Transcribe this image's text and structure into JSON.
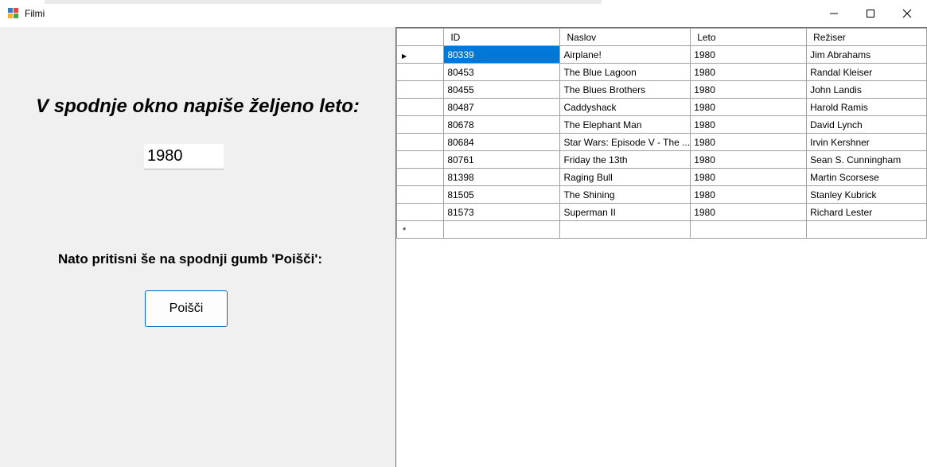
{
  "window": {
    "title": "Filmi",
    "icon": "app-form-icon",
    "controls": [
      "minimize-icon",
      "maximize-icon",
      "close-icon"
    ]
  },
  "form": {
    "prompt_title": "V spodnje okno napiše željeno leto:",
    "year_value": "1980",
    "instruction": "Nato pritisni še na spodnji gumb 'Poišči':",
    "search_label": "Poišči"
  },
  "grid": {
    "columns": [
      "ID",
      "Naslov",
      "Leto",
      "Režiser"
    ],
    "rows": [
      {
        "id": "80339",
        "naslov": "Airplane!",
        "leto": "1980",
        "reziser": "Jim Abrahams"
      },
      {
        "id": "80453",
        "naslov": "The Blue Lagoon",
        "leto": "1980",
        "reziser": "Randal Kleiser"
      },
      {
        "id": "80455",
        "naslov": "The Blues Brothers",
        "leto": "1980",
        "reziser": "John Landis"
      },
      {
        "id": "80487",
        "naslov": "Caddyshack",
        "leto": "1980",
        "reziser": "Harold Ramis"
      },
      {
        "id": "80678",
        "naslov": "The Elephant Man",
        "leto": "1980",
        "reziser": "David Lynch"
      },
      {
        "id": "80684",
        "naslov": "Star Wars: Episode V - The ...",
        "leto": "1980",
        "reziser": "Irvin Kershner"
      },
      {
        "id": "80761",
        "naslov": "Friday the 13th",
        "leto": "1980",
        "reziser": "Sean S. Cunningham"
      },
      {
        "id": "81398",
        "naslov": "Raging Bull",
        "leto": "1980",
        "reziser": "Martin Scorsese"
      },
      {
        "id": "81505",
        "naslov": "The Shining",
        "leto": "1980",
        "reziser": "Stanley Kubrick"
      },
      {
        "id": "81573",
        "naslov": "Superman II",
        "leto": "1980",
        "reziser": "Richard Lester"
      }
    ],
    "current_row_marker": "▶",
    "new_row_marker": "*",
    "selection_color": "#0078d7"
  }
}
